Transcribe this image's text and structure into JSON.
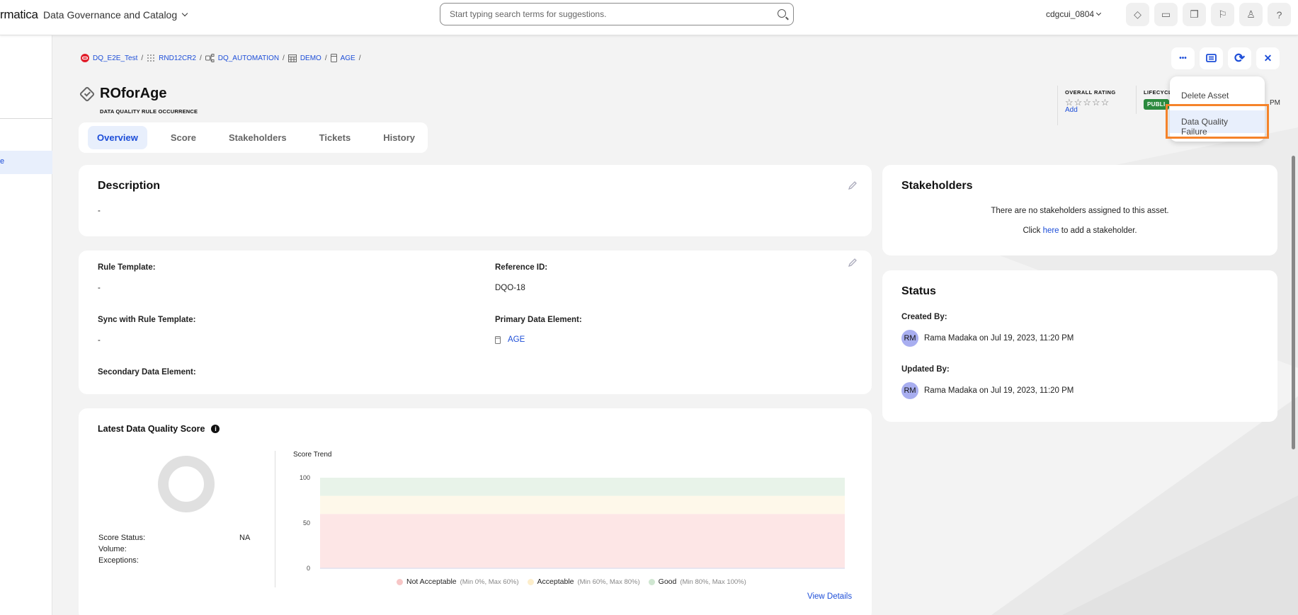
{
  "topbar": {
    "brand": "rmatica",
    "app_name": "Data Governance and Catalog",
    "search_placeholder": "Start typing search terms for suggestions.",
    "search_value": "",
    "user": "cdgcui_0804",
    "icons": [
      "ticket-icon",
      "inbox-icon",
      "copy-icon",
      "flag-icon",
      "user-icon",
      "help-icon"
    ],
    "icon_glyphs": [
      "◇",
      "▭",
      "❐",
      "⚐",
      "♙",
      "?"
    ]
  },
  "leftnav": {
    "active_item_partial": "e"
  },
  "breadcrumb": [
    {
      "label": "DQ_E2E_Test",
      "icon": "oracle-icon"
    },
    {
      "label": "RND12CR2",
      "icon": "grid-dots-icon"
    },
    {
      "label": "DQ_AUTOMATION",
      "icon": "schema-icon"
    },
    {
      "label": "DEMO",
      "icon": "table-icon"
    },
    {
      "label": "AGE",
      "icon": "column-icon"
    }
  ],
  "breadcrumb_separator": "/",
  "header": {
    "title": "ROforAge",
    "subtitle": "DATA QUALITY RULE OCCURRENCE",
    "rating_label": "OVERALL RATING",
    "rating_stars": "☆☆☆☆☆",
    "rating_value": 0,
    "rating_add": "Add",
    "lifecycle_label": "LIFECYCL",
    "lifecycle_value": "PUBLI",
    "partial_time": "PM",
    "actions": {
      "more": "•••",
      "comment": "☰",
      "refresh": "⟳",
      "close": "✕"
    }
  },
  "dropdown": {
    "items": [
      "Delete Asset",
      "Data Quality Failure"
    ],
    "hovered": "Data Quality Failure"
  },
  "tabs": [
    {
      "label": "Overview",
      "active": true
    },
    {
      "label": "Score",
      "active": false
    },
    {
      "label": "Stakeholders",
      "active": false
    },
    {
      "label": "Tickets",
      "active": false
    },
    {
      "label": "History",
      "active": false
    }
  ],
  "description": {
    "title": "Description",
    "value": "-"
  },
  "details": {
    "rule_template_label": "Rule Template:",
    "rule_template_value": "-",
    "sync_label": "Sync with Rule Template:",
    "sync_value": "-",
    "secondary_label": "Secondary Data Element:",
    "reference_id_label": "Reference ID:",
    "reference_id_value": "DQO-18",
    "primary_label": "Primary Data Element:",
    "primary_value": "AGE"
  },
  "stakeholders": {
    "title": "Stakeholders",
    "empty_text": "There are no stakeholders assigned to this asset.",
    "click_prefix": "Click ",
    "click_link": "here",
    "click_suffix": " to add a stakeholder."
  },
  "status": {
    "title": "Status",
    "created_label": "Created By:",
    "created_initials": "RM",
    "created_text": "Rama Madaka on Jul 19, 2023, 11:20 PM",
    "updated_label": "Updated By:",
    "updated_initials": "RM",
    "updated_text": "Rama Madaka on Jul 19, 2023, 11:20 PM"
  },
  "score": {
    "title": "Latest Data Quality Score",
    "info_icon": "i",
    "score_status_label": "Score Status:",
    "score_status_value": "NA",
    "volume_label": "Volume:",
    "volume_value": "",
    "exceptions_label": "Exceptions:",
    "exceptions_value": "",
    "view_details": "View Details"
  },
  "chart_data": {
    "type": "area",
    "title": "Score Trend",
    "xlabel": "",
    "ylabel": "",
    "ylim": [
      0,
      100
    ],
    "yticks": [
      0,
      50,
      100
    ],
    "bands": [
      {
        "name": "Not Acceptable",
        "range_label": "(Min 0%, Max 60%)",
        "min": 0,
        "max": 60,
        "color": "#fde6e6",
        "dot": "#f7c6c6"
      },
      {
        "name": "Acceptable",
        "range_label": "(Min 60%, Max 80%)",
        "min": 60,
        "max": 80,
        "color": "#fef8ea",
        "dot": "#fdeecb"
      },
      {
        "name": "Good",
        "range_label": "(Min 80%, Max 100%)",
        "min": 80,
        "max": 100,
        "color": "#e8f3e9",
        "dot": "#cfe6d1"
      }
    ],
    "series": [],
    "legend_position": "bottom"
  },
  "colors": {
    "accent": "#1d4ed8",
    "highlight": "#f5832a",
    "lifecycle": "#2b8a3e",
    "avatar": "#a8aef0"
  }
}
